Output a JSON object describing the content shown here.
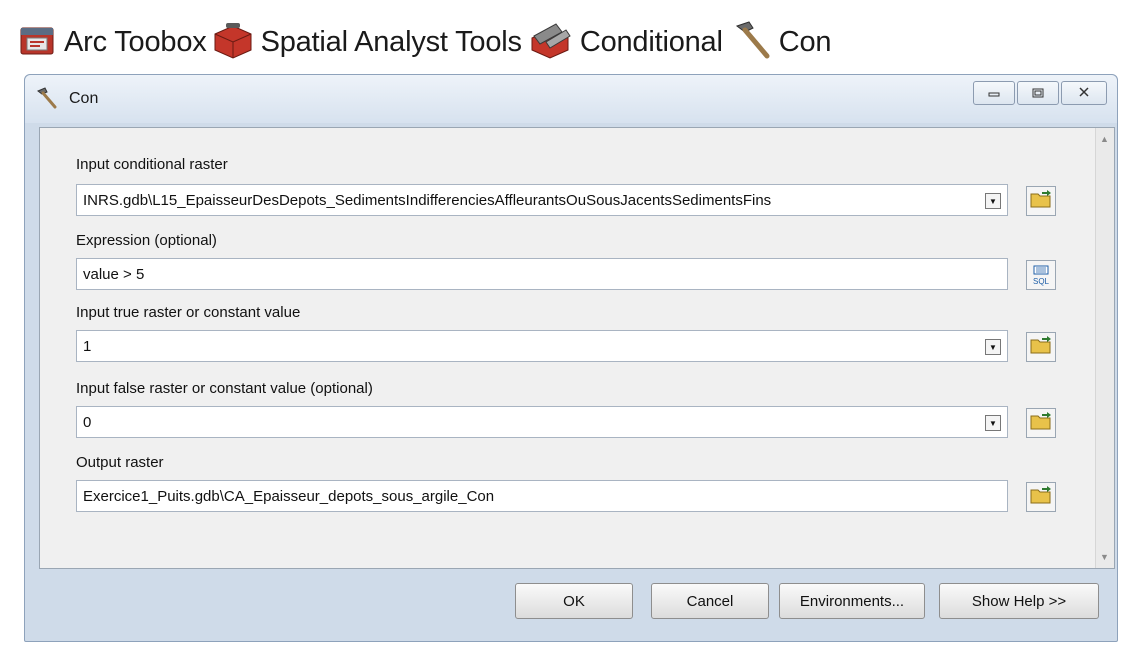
{
  "breadcrumb": {
    "items": [
      {
        "label": "Arc Toobox",
        "icon": "arctoolbox-icon"
      },
      {
        "label": "Spatial Analyst Tools",
        "icon": "toolbox-icon"
      },
      {
        "label": "Conditional",
        "icon": "toolset-icon"
      },
      {
        "label": "Con",
        "icon": "hammer-icon"
      }
    ]
  },
  "window": {
    "title": "Con",
    "title_icon": "hammer-icon",
    "controls": {
      "minimize": "minimize-icon",
      "maximize": "maximize-icon",
      "close": "close-icon"
    }
  },
  "form": {
    "conditional": {
      "label": "Input conditional raster",
      "value": "INRS.gdb\\L15_EpaisseurDesDepots_SedimentsIndifferenciesAffleurantsOuSousJacentsSedimentsFins"
    },
    "expression": {
      "label": "Expression (optional)",
      "value": "value > 5",
      "button_text": "SQL"
    },
    "true_value": {
      "label": "Input true raster or constant value",
      "value": "1"
    },
    "false_value": {
      "label": "Input false raster or constant value (optional)",
      "value": "0"
    },
    "output": {
      "label": "Output raster",
      "value": "Exercice1_Puits.gdb\\CA_Epaisseur_depots_sous_argile_Con"
    }
  },
  "buttons": {
    "ok": "OK",
    "cancel": "Cancel",
    "environments": "Environments...",
    "help": "Show Help >>"
  },
  "colors": {
    "folder": "#e8c24a",
    "toolbox_red": "#c0392b",
    "accent": "#1f5fa8"
  }
}
